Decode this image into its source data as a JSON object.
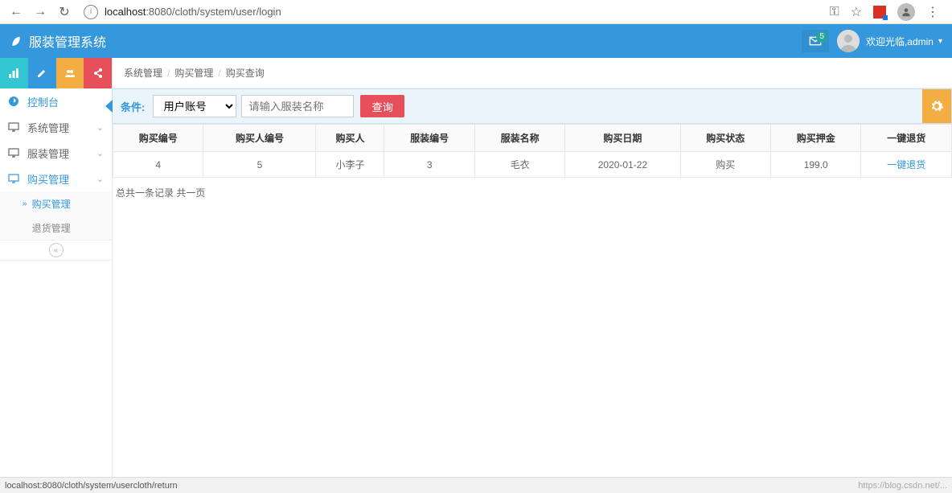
{
  "browser": {
    "url_host": "localhost",
    "url_path": ":8080/cloth/system/user/login",
    "key_icon": "⊸",
    "star_icon": "☆",
    "menu_icon": "⋮"
  },
  "header": {
    "brand": "服装管理系统",
    "mail_badge": "5",
    "greeting": "欢迎光临,admin"
  },
  "sidebar": {
    "dashboard": "控制台",
    "items": [
      {
        "icon": "display",
        "label": "系统管理"
      },
      {
        "icon": "display",
        "label": "服装管理"
      },
      {
        "icon": "display",
        "label": "购买管理"
      }
    ],
    "submenu": [
      {
        "label": "购买管理",
        "active": true
      },
      {
        "label": "退货管理",
        "active": false
      }
    ]
  },
  "breadcrumb": [
    "系统管理",
    "购买管理",
    "购买查询"
  ],
  "filter": {
    "label": "条件:",
    "select_value": "用户账号",
    "placeholder": "请输入服装名称",
    "search_btn": "查询"
  },
  "table": {
    "headers": [
      "购买编号",
      "购买人编号",
      "购买人",
      "服装编号",
      "服装名称",
      "购买日期",
      "购买状态",
      "购买押金",
      "一键退货"
    ],
    "rows": [
      {
        "c0": "4",
        "c1": "5",
        "c2": "小李子",
        "c3": "3",
        "c4": "毛衣",
        "c5": "2020-01-22",
        "c6": "购买",
        "c7": "199.0",
        "c8": "一键退货"
      }
    ]
  },
  "pager_text": "总共一条记录 共一页",
  "status_left": "localhost:8080/cloth/system/usercloth/return",
  "status_right": "https://blog.csdn.net/..."
}
